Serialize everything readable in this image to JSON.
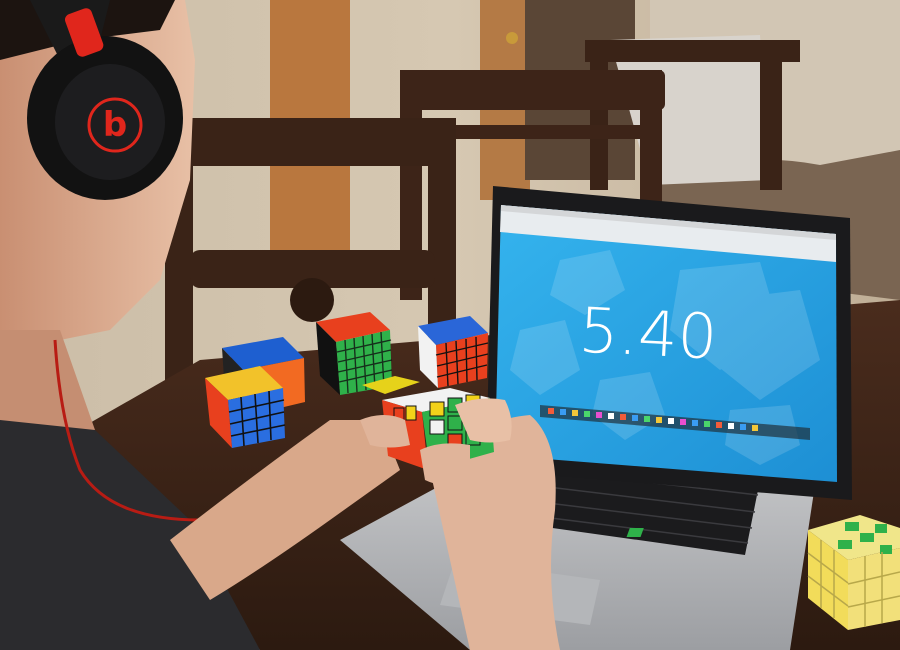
{
  "laptop": {
    "timer_value": "5.40",
    "screen_color": "#2aa8e6",
    "screen_color_dark": "#1e8fd0"
  },
  "headphones": {
    "brand_mark": "b",
    "accent_color": "#e0261c"
  },
  "colors": {
    "table": "#3b2418",
    "wall": "#c9b9a2",
    "chair": "#3a2317",
    "shirt": "#2b2b2e",
    "skin": "#e0b49a"
  },
  "objects": [
    "person-with-headphones",
    "laptop-showing-timer",
    "rubiks-cube-in-hands",
    "cube-5x5",
    "cube-6x6",
    "cube-4x4-blue-white",
    "cube-4x4-orange-blue",
    "cube-yellow-green-3x3",
    "cube-yellow-small"
  ]
}
